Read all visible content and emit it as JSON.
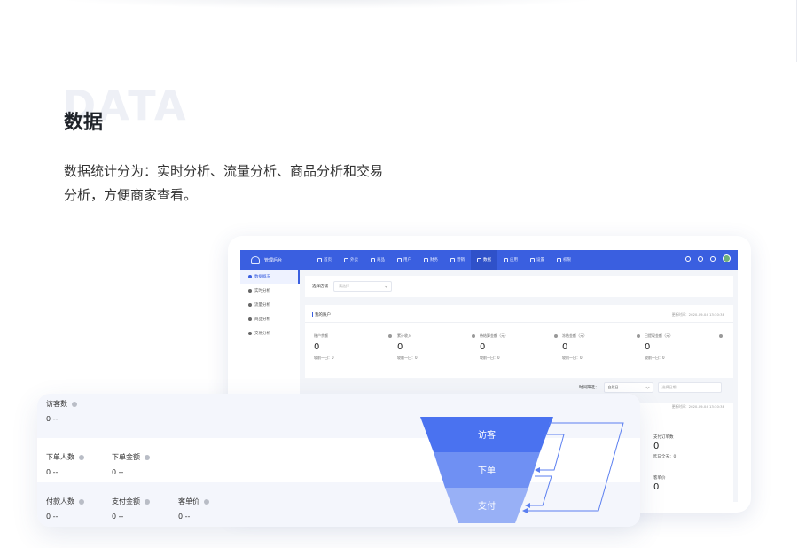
{
  "section": {
    "bg_word": "DATA",
    "title": "数据",
    "description": "数据统计分为：实时分析、流量分析、商品分析和交易分析，方便商家查看。"
  },
  "topbar": {
    "app_name": "管理后台",
    "nav": [
      {
        "label": "首页",
        "icon": "home-icon"
      },
      {
        "label": "外卖",
        "icon": "takeout-icon"
      },
      {
        "label": "商品",
        "icon": "product-icon"
      },
      {
        "label": "用户",
        "icon": "user-icon"
      },
      {
        "label": "财务",
        "icon": "finance-icon"
      },
      {
        "label": "营销",
        "icon": "marketing-icon"
      },
      {
        "label": "数据",
        "icon": "data-icon",
        "active": true
      },
      {
        "label": "应用",
        "icon": "app-icon"
      },
      {
        "label": "设置",
        "icon": "settings-icon"
      },
      {
        "label": "权限",
        "icon": "permission-icon"
      }
    ],
    "accent": "#3a5fe0"
  },
  "sidebar": {
    "items": [
      {
        "label": "数据概况",
        "active": true
      },
      {
        "label": "实时分析"
      },
      {
        "label": "流量分析"
      },
      {
        "label": "商品分析"
      },
      {
        "label": "交易分析"
      }
    ]
  },
  "filter": {
    "label": "选择店铺",
    "placeholder": "请选择"
  },
  "account": {
    "heading": "我的账户",
    "updated": "更新时间：2020-09-04 13:30:38",
    "metrics": [
      {
        "label": "账户余额",
        "value": "0",
        "prev": "较前一日：0"
      },
      {
        "label": "累计收入",
        "value": "0",
        "prev": "较前一日：0"
      },
      {
        "label": "待结算金额（元）",
        "value": "0",
        "prev": "较前一日：0"
      },
      {
        "label": "冻结金额（元）",
        "value": "0",
        "prev": "较前一日：0"
      },
      {
        "label": "已提现金额（元）",
        "value": "0",
        "prev": "较前一日：0"
      }
    ]
  },
  "time_filter": {
    "label": "时间筛选：",
    "selected": "自然日",
    "date_placeholder": "选择日期"
  },
  "panel2": {
    "updated": "更新时间：2020-09-04 13:30:38",
    "pay_orders_label": "支付订单数",
    "pay_orders_value": "0",
    "pay_orders_prev": "昨日全天：0",
    "avg_price_label": "客单价",
    "avg_price_value": "0"
  },
  "overlay": {
    "row1": [
      {
        "label": "访客数",
        "value": "0 --"
      }
    ],
    "row2": [
      {
        "label": "下单人数",
        "value": "0 --"
      },
      {
        "label": "下单金额",
        "value": "0 --"
      }
    ],
    "row3": [
      {
        "label": "付款人数",
        "value": "0 --"
      },
      {
        "label": "支付金额",
        "value": "0 --"
      },
      {
        "label": "客单价",
        "value": "0 --"
      }
    ]
  },
  "funnel": {
    "stages": [
      {
        "label": "访客",
        "color": "#4a72f0"
      },
      {
        "label": "下单",
        "color": "#6f90f3"
      },
      {
        "label": "支付",
        "color": "#98b0f6"
      }
    ],
    "arrow_color": "#5b7ff0"
  }
}
